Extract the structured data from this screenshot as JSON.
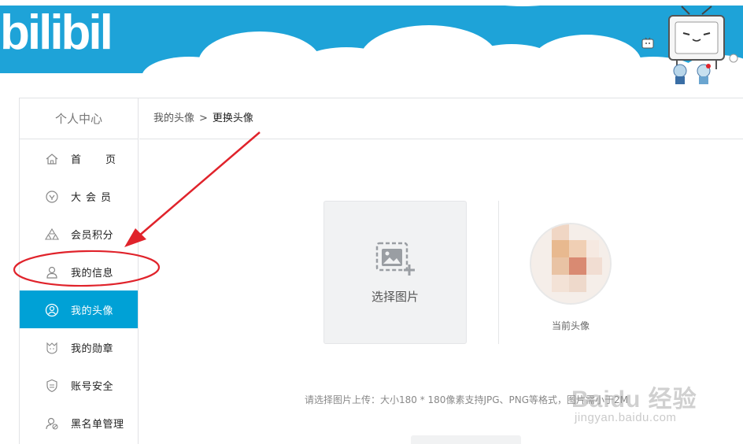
{
  "header": {
    "logo_text": "bilibili"
  },
  "sidebar": {
    "title": "个人中心",
    "items": [
      {
        "label": "首　页",
        "icon": "home-icon"
      },
      {
        "label": "大会员",
        "icon": "vip-icon"
      },
      {
        "label": "会员积分",
        "icon": "points-icon"
      },
      {
        "label": "我的信息",
        "icon": "user-icon"
      },
      {
        "label": "我的头像",
        "icon": "avatar-icon",
        "active": true
      },
      {
        "label": "我的勋章",
        "icon": "medal-icon"
      },
      {
        "label": "账号安全",
        "icon": "shield-icon"
      },
      {
        "label": "黑名单管理",
        "icon": "blacklist-icon"
      }
    ],
    "active_color": "#00a1d6"
  },
  "breadcrumb": {
    "parent": "我的头像",
    "separator": ">",
    "current": "更换头像"
  },
  "upload": {
    "label": "选择图片"
  },
  "avatar": {
    "caption": "当前头像"
  },
  "hint": "请选择图片上传：大小180 * 180像素支持JPG、PNG等格式，图片需小于2M",
  "watermark": {
    "main": "Baidu 经验",
    "sub": "jingyan.baidu.com"
  },
  "colors": {
    "banner_blue": "#1ea3d8",
    "accent": "#00a1d6",
    "annotation_red": "#e0232b"
  }
}
